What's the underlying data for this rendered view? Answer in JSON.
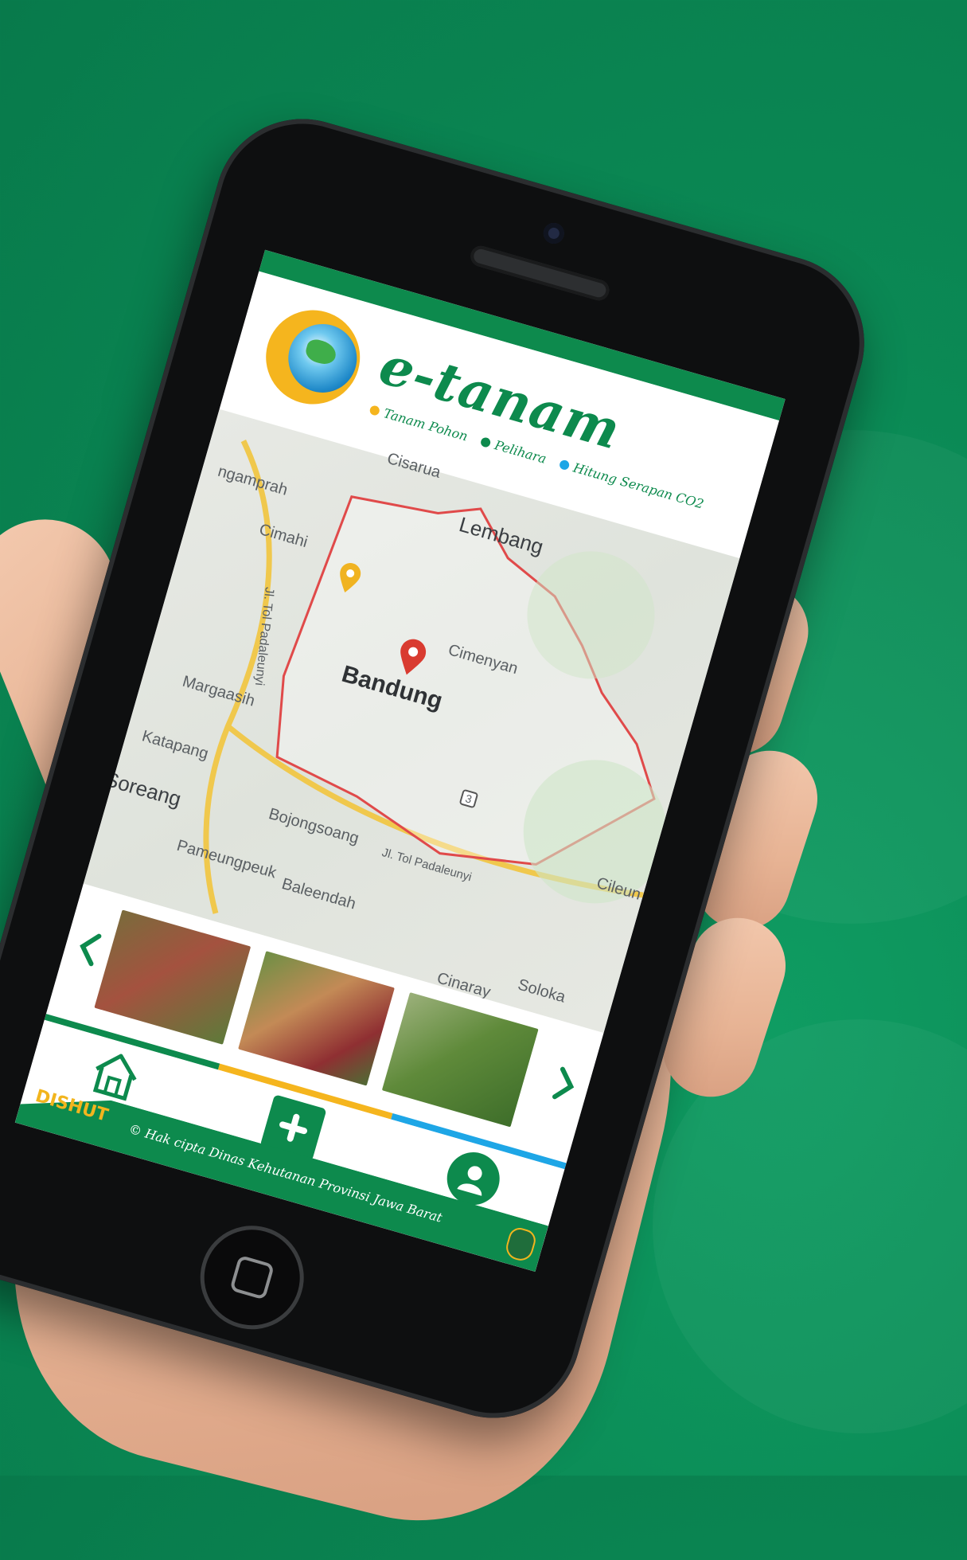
{
  "app": {
    "title": "e-tanam",
    "tagline": [
      {
        "label": "Tanam Pohon",
        "color": "#f5b51e"
      },
      {
        "label": "Pelihara",
        "color": "#0d8a4d"
      },
      {
        "label": "Hitung Serapan CO2",
        "color": "#1ea6e6"
      }
    ]
  },
  "map": {
    "city": "Bandung",
    "labels": [
      {
        "id": "cisarua",
        "text": "Cisarua"
      },
      {
        "id": "lembang",
        "text": "Lembang"
      },
      {
        "id": "ngamprah",
        "text": "ngamprah"
      },
      {
        "id": "cimahi",
        "text": "Cimahi"
      },
      {
        "id": "cimenyan",
        "text": "Cimenyan"
      },
      {
        "id": "tol-west",
        "text": "Jl. Tol Padaleunyi"
      },
      {
        "id": "margaasih",
        "text": "Margaasih"
      },
      {
        "id": "katapang",
        "text": "Katapang"
      },
      {
        "id": "soreang",
        "text": "Soreang"
      },
      {
        "id": "bojongsoang",
        "text": "Bojongsoang"
      },
      {
        "id": "tol-south",
        "text": "Jl. Tol Padaleunyi"
      },
      {
        "id": "pameungpeuk",
        "text": "Pameungpeuk"
      },
      {
        "id": "baleendah",
        "text": "Baleendah"
      },
      {
        "id": "cileunyi",
        "text": "Cileun"
      },
      {
        "id": "solokan",
        "text": "Soloka"
      },
      {
        "id": "cinaray",
        "text": "Cinaray"
      },
      {
        "id": "road-3",
        "text": "3"
      }
    ]
  },
  "carousel": {
    "images": [
      "planting-group",
      "farmer-seedlings",
      "nursery-beds"
    ]
  },
  "progress_colors": [
    "#0d8a4d",
    "#f5b51e",
    "#1ea6e6"
  ],
  "footer": {
    "copyright": "© Hak cipta Dinas Kehutanan Provinsi Jawa Barat",
    "logo": "DISHUT"
  }
}
